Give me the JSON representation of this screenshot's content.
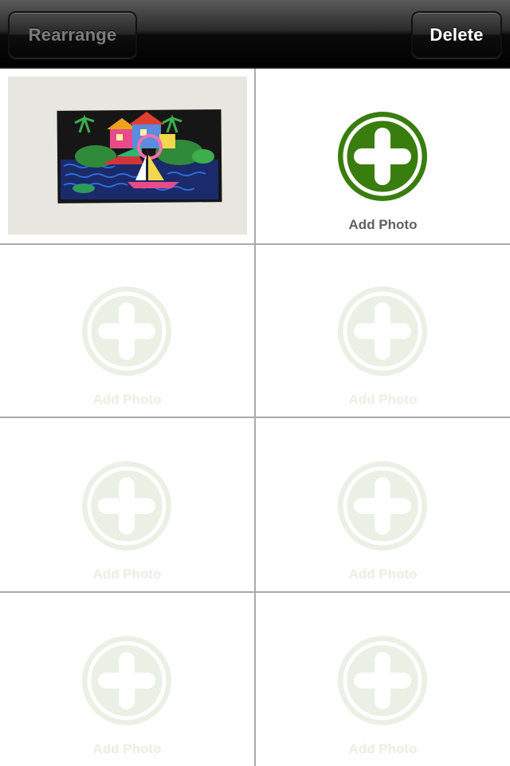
{
  "toolbar": {
    "rearrange_label": "Rearrange",
    "delete_label": "Delete"
  },
  "grid": {
    "add_photo_label": "Add Photo",
    "slot_count": 8,
    "filled_slots": 1
  },
  "colors": {
    "toolbar_bg": "#000000",
    "add_active_green": "#3a7d0f",
    "add_faded_green": "#eaf0e4",
    "divider": "#a9a9a9"
  },
  "icons": {
    "add": "plus-circle-icon"
  }
}
